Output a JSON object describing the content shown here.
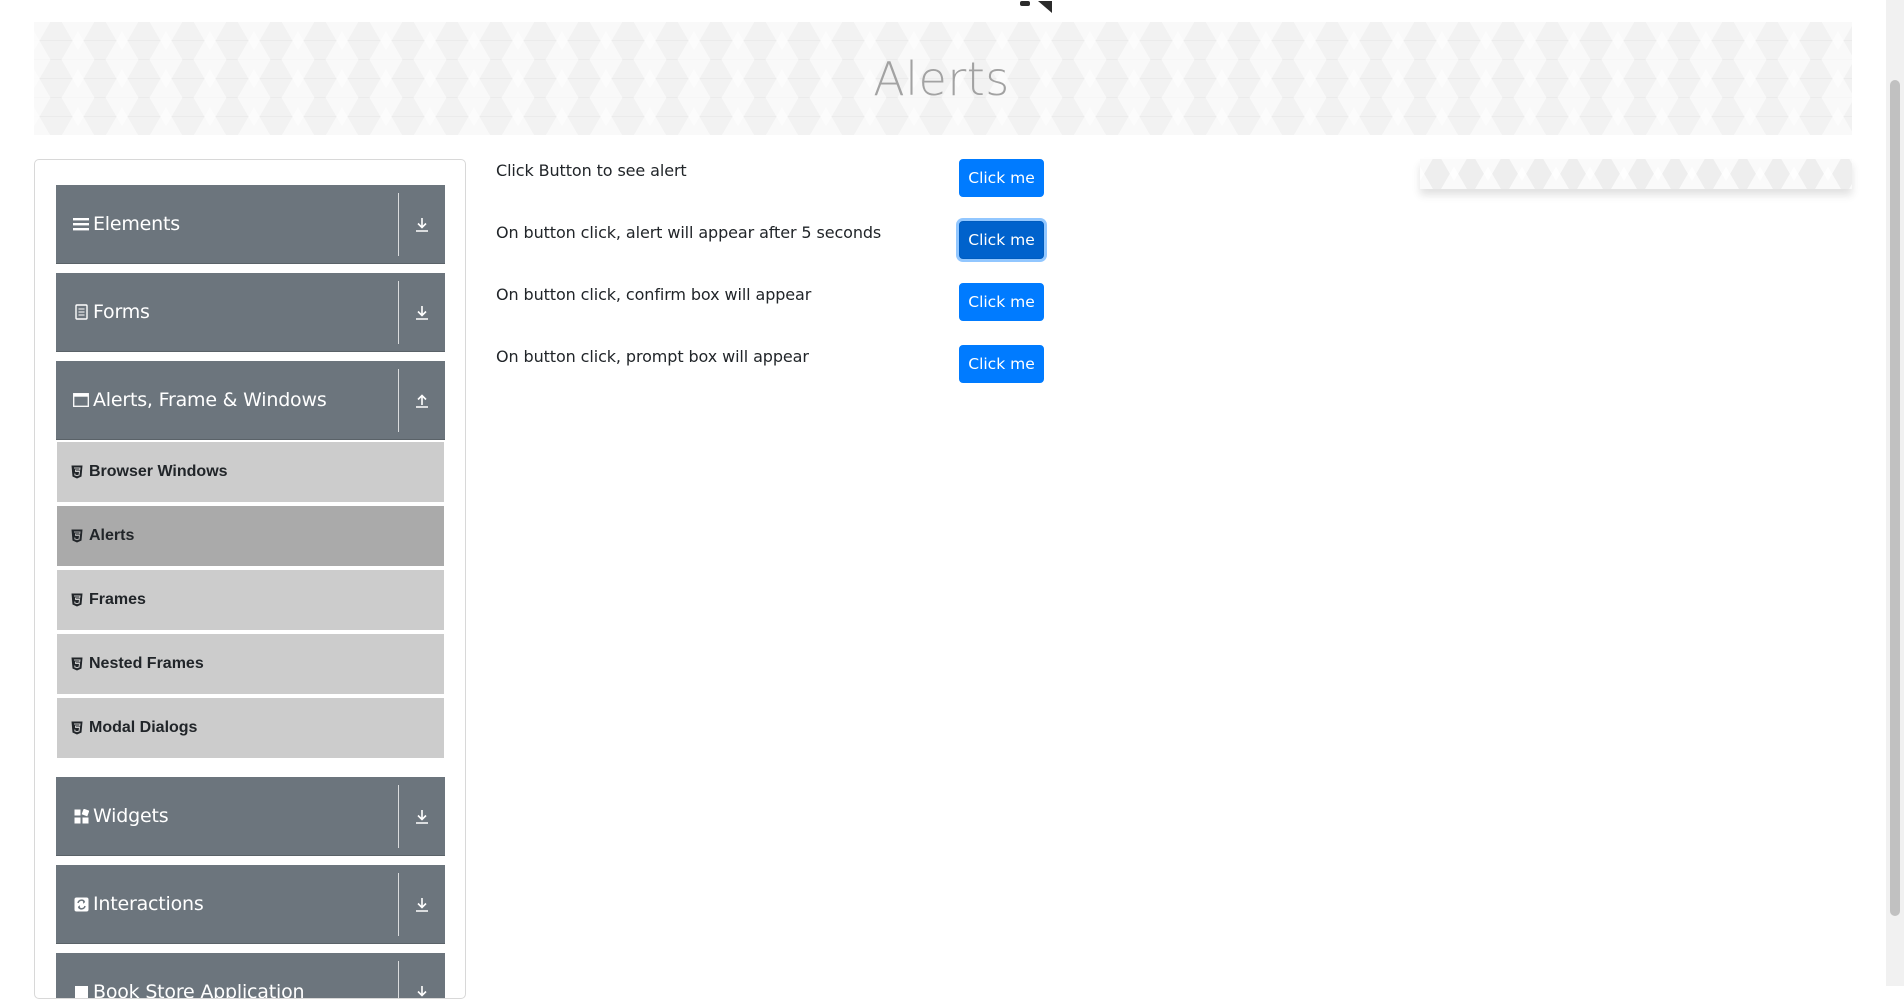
{
  "banner": {
    "title": "Alerts"
  },
  "sidebar": {
    "groups": [
      {
        "label": "Elements",
        "icon": "hamburger-icon",
        "arrow": "download-arrow-icon"
      },
      {
        "label": "Forms",
        "icon": "document-icon",
        "arrow": "download-arrow-icon"
      },
      {
        "label": "Alerts, Frame & Windows",
        "icon": "window-icon",
        "arrow": "upload-arrow-icon"
      },
      {
        "label": "Widgets",
        "icon": "widgets-grid-icon",
        "arrow": "download-arrow-icon"
      },
      {
        "label": "Interactions",
        "icon": "interactions-icon",
        "arrow": "download-arrow-icon"
      },
      {
        "label": "Book Store Application",
        "icon": "book-icon",
        "arrow": "download-arrow-icon"
      }
    ],
    "items": [
      {
        "label": "Browser Windows",
        "icon": "html5-icon"
      },
      {
        "label": "Alerts",
        "icon": "html5-icon",
        "active": true
      },
      {
        "label": "Frames",
        "icon": "html5-icon"
      },
      {
        "label": "Nested Frames",
        "icon": "html5-icon"
      },
      {
        "label": "Modal Dialogs",
        "icon": "html5-icon"
      }
    ]
  },
  "main": {
    "rows": [
      {
        "text": "Click Button to see alert",
        "button": "Click me"
      },
      {
        "text": "On button click, alert will appear after 5 seconds",
        "button": "Click me"
      },
      {
        "text": "On button click, confirm box will appear",
        "button": "Click me"
      },
      {
        "text": "On button click, prompt box will appear",
        "button": "Click me"
      }
    ]
  },
  "colors": {
    "primary": "#007bff",
    "sidebar_group": "#6c757d",
    "sidebar_item": "#cccccc",
    "sidebar_item_active": "#aaaaaa"
  }
}
